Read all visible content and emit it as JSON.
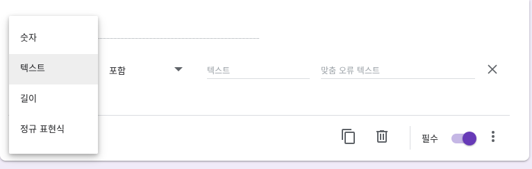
{
  "validation_menu": {
    "items": [
      {
        "label": "숫자",
        "selected": false
      },
      {
        "label": "텍스트",
        "selected": true
      },
      {
        "label": "길이",
        "selected": false
      },
      {
        "label": "정규 표현식",
        "selected": false
      }
    ]
  },
  "condition": {
    "selected": "포함"
  },
  "text_field": {
    "placeholder": "텍스트",
    "value": ""
  },
  "error_field": {
    "placeholder": "맞춤 오류 텍스트",
    "value": ""
  },
  "footer": {
    "required_label": "필수",
    "required_on": true,
    "accent_color": "#673ab7"
  },
  "icons": {
    "copy": "copy-icon",
    "delete": "trash-icon",
    "close": "close-icon",
    "more": "more-vert-icon",
    "dropdown": "chevron-down-icon"
  }
}
